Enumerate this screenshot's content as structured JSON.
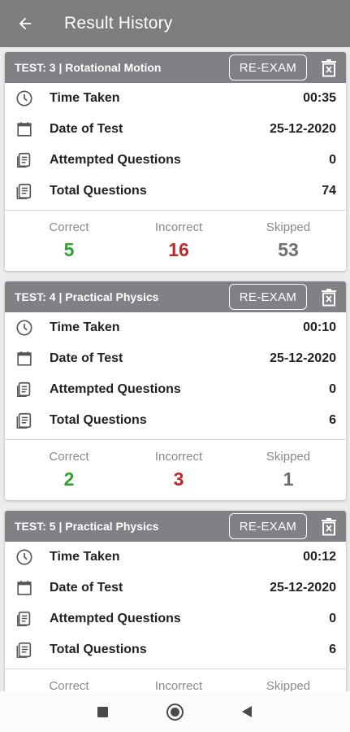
{
  "appbar": {
    "title": "Result History",
    "back_icon": "arrow-left-icon"
  },
  "common": {
    "reexam_label": "RE-EXAM",
    "time_label": "Time Taken",
    "date_label": "Date of Test",
    "attempted_label": "Attempted Questions",
    "total_label": "Total Questions",
    "correct_label": "Correct",
    "incorrect_label": "Incorrect",
    "skipped_label": "Skipped"
  },
  "colors": {
    "correct": "#2fa52f",
    "incorrect": "#c0282b",
    "skipped": "#6f6f6f",
    "header": "#808184",
    "appbar": "#7b7d7f"
  },
  "cards": [
    {
      "title": "TEST: 3 | Rotational Motion",
      "time": "00:35",
      "date": "25-12-2020",
      "attempted": "0",
      "total": "74",
      "correct": "5",
      "incorrect": "16",
      "skipped": "53"
    },
    {
      "title": "TEST: 4 | Practical Physics",
      "time": "00:10",
      "date": "25-12-2020",
      "attempted": "0",
      "total": "6",
      "correct": "2",
      "incorrect": "3",
      "skipped": "1"
    },
    {
      "title": "TEST: 5 | Practical Physics",
      "time": "00:12",
      "date": "25-12-2020",
      "attempted": "0",
      "total": "6",
      "correct": "",
      "incorrect": "",
      "skipped": ""
    }
  ]
}
